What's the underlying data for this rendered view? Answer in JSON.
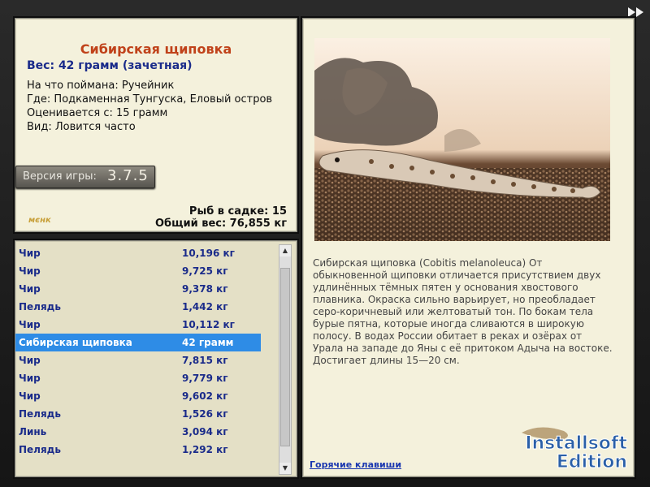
{
  "fish": {
    "title": "Сибирская щиповка",
    "weight_line": "Вес: 42 грамм (зачетная)",
    "details": [
      "На что поймана: Ручейник",
      "Где: Подкаменная Тунгуска, Еловый остров",
      "Оценивается с: 15 грамм",
      "Вид: Ловится часто"
    ]
  },
  "version": {
    "label": "Версия игры:",
    "number": "3.7.5"
  },
  "logo_text": "мєнк",
  "stats": {
    "fish_count": "Рыб в садке: 15",
    "total_weight": "Общий вес: 76,855 кг"
  },
  "catch_list": [
    {
      "name": "Чир",
      "weight": "10,196 кг"
    },
    {
      "name": "Чир",
      "weight": "9,725 кг"
    },
    {
      "name": "Чир",
      "weight": "9,378 кг"
    },
    {
      "name": "Пелядь",
      "weight": "1,442 кг"
    },
    {
      "name": "Чир",
      "weight": "10,112 кг"
    },
    {
      "name": "Сибирская щиповка",
      "weight": "42 грамм",
      "selected": true
    },
    {
      "name": "Чир",
      "weight": "7,815 кг"
    },
    {
      "name": "Чир",
      "weight": "9,779 кг"
    },
    {
      "name": "Чир",
      "weight": "9,602 кг"
    },
    {
      "name": "Пелядь",
      "weight": "1,526 кг"
    },
    {
      "name": "Линь",
      "weight": "3,094 кг"
    },
    {
      "name": "Пелядь",
      "weight": "1,292 кг"
    }
  ],
  "description": "Сибирская щиповка (Cobitis melanoleuca) От обыкновенной щиповки отличается присутствием двух удлинённых тёмных пятен у основания хвостового плавника. Окраска сильно варьирует, но преобладает серо-коричневый или желтоватый тон. По бокам тела бурые пятна, которые иногда сливаются в широкую полосу. В водах России обитает в реках и озёрах от Урала на западе до Яны с её притоком Адыча на востоке. Достигает длины 15—20 см.",
  "hotkeys_link": "Горячие клавиши",
  "watermark": {
    "line1": "Installsoft",
    "line2": "Edition"
  },
  "icons": {
    "forward": "fast-forward-icon",
    "scroll_up": "scroll-up-icon",
    "scroll_down": "scroll-down-icon"
  }
}
